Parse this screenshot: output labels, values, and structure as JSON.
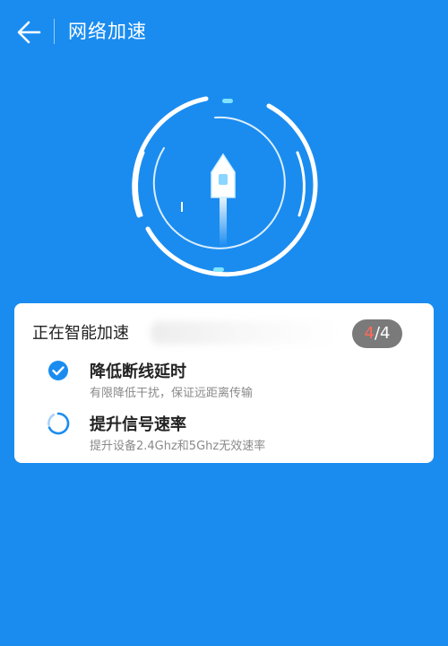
{
  "header": {
    "title": "网络加速",
    "back_icon": "arrow-left-icon"
  },
  "colors": {
    "background": "#1a8cf0",
    "card": "#ffffff",
    "accent": "#1a8cf0",
    "progress_current": "#ff6b5b"
  },
  "status": {
    "title": "正在智能加速",
    "progress_current": "4",
    "progress_total": "/4"
  },
  "tasks": [
    {
      "name": "降低断线延时",
      "desc": "有限降低干扰，保证远距离传输",
      "state": "done",
      "icon": "check-circle-icon"
    },
    {
      "name": "提升信号速率",
      "desc": "提升设备2.4Ghz和5Ghz无效速率",
      "state": "in-progress",
      "icon": "spinner-icon"
    }
  ]
}
